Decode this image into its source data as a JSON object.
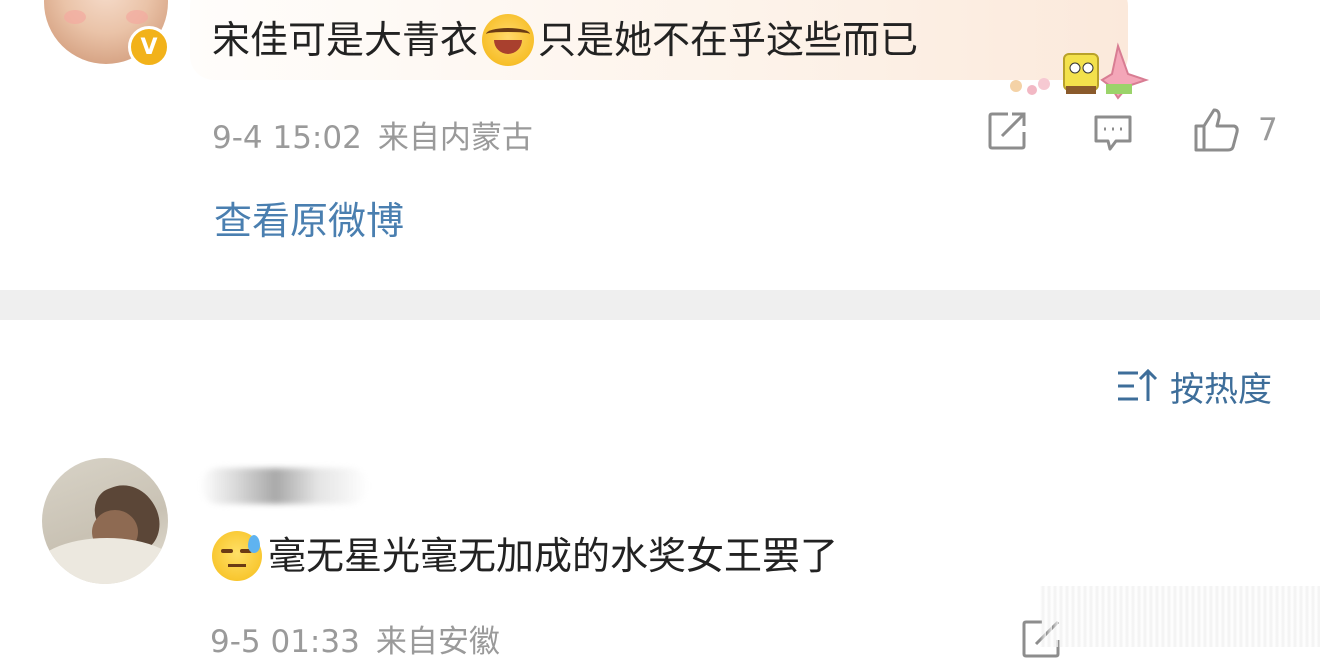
{
  "comments": [
    {
      "text_before_emoji": "宋佳可是大青衣",
      "emoji": "laugh-cry-emoji",
      "text_after_emoji": "只是她不在乎这些而已",
      "verified_badge": "V",
      "time": "9-4 15:02",
      "location": "来自内蒙古",
      "like_count": "7",
      "view_original_label": "查看原微博"
    },
    {
      "emoji": "sweat-emoji",
      "text": "毫无星光毫无加成的水奖女王罢了",
      "time": "9-5 01:33",
      "location": "来自安徽"
    }
  ],
  "sort": {
    "label": "按热度"
  },
  "colors": {
    "link": "#4a7fb0",
    "meta": "#9a9a9a",
    "sort": "#3e6e9a",
    "divider": "#efefef",
    "badge": "#f2b21a"
  }
}
